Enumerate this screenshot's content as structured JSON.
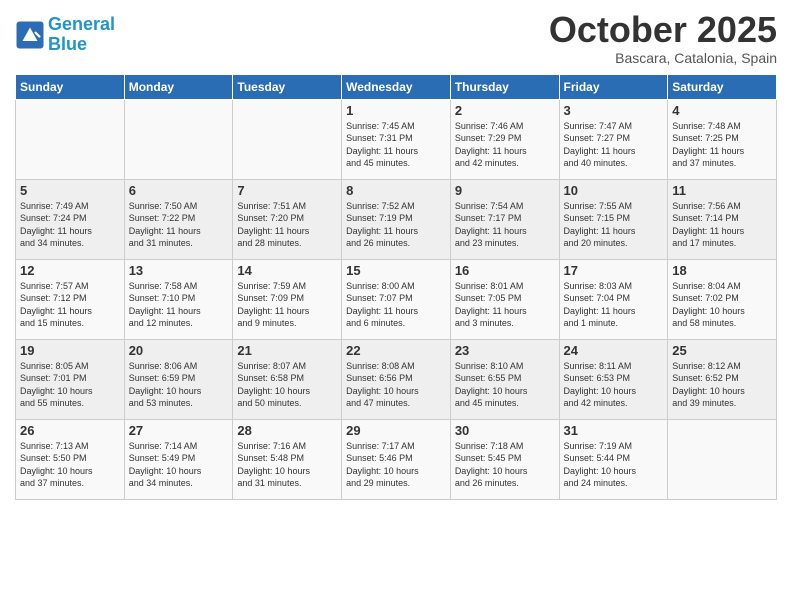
{
  "header": {
    "logo_line1": "General",
    "logo_line2": "Blue",
    "month": "October 2025",
    "location": "Bascara, Catalonia, Spain"
  },
  "days_of_week": [
    "Sunday",
    "Monday",
    "Tuesday",
    "Wednesday",
    "Thursday",
    "Friday",
    "Saturday"
  ],
  "weeks": [
    [
      {
        "day": "",
        "info": ""
      },
      {
        "day": "",
        "info": ""
      },
      {
        "day": "",
        "info": ""
      },
      {
        "day": "1",
        "info": "Sunrise: 7:45 AM\nSunset: 7:31 PM\nDaylight: 11 hours\nand 45 minutes."
      },
      {
        "day": "2",
        "info": "Sunrise: 7:46 AM\nSunset: 7:29 PM\nDaylight: 11 hours\nand 42 minutes."
      },
      {
        "day": "3",
        "info": "Sunrise: 7:47 AM\nSunset: 7:27 PM\nDaylight: 11 hours\nand 40 minutes."
      },
      {
        "day": "4",
        "info": "Sunrise: 7:48 AM\nSunset: 7:25 PM\nDaylight: 11 hours\nand 37 minutes."
      }
    ],
    [
      {
        "day": "5",
        "info": "Sunrise: 7:49 AM\nSunset: 7:24 PM\nDaylight: 11 hours\nand 34 minutes."
      },
      {
        "day": "6",
        "info": "Sunrise: 7:50 AM\nSunset: 7:22 PM\nDaylight: 11 hours\nand 31 minutes."
      },
      {
        "day": "7",
        "info": "Sunrise: 7:51 AM\nSunset: 7:20 PM\nDaylight: 11 hours\nand 28 minutes."
      },
      {
        "day": "8",
        "info": "Sunrise: 7:52 AM\nSunset: 7:19 PM\nDaylight: 11 hours\nand 26 minutes."
      },
      {
        "day": "9",
        "info": "Sunrise: 7:54 AM\nSunset: 7:17 PM\nDaylight: 11 hours\nand 23 minutes."
      },
      {
        "day": "10",
        "info": "Sunrise: 7:55 AM\nSunset: 7:15 PM\nDaylight: 11 hours\nand 20 minutes."
      },
      {
        "day": "11",
        "info": "Sunrise: 7:56 AM\nSunset: 7:14 PM\nDaylight: 11 hours\nand 17 minutes."
      }
    ],
    [
      {
        "day": "12",
        "info": "Sunrise: 7:57 AM\nSunset: 7:12 PM\nDaylight: 11 hours\nand 15 minutes."
      },
      {
        "day": "13",
        "info": "Sunrise: 7:58 AM\nSunset: 7:10 PM\nDaylight: 11 hours\nand 12 minutes."
      },
      {
        "day": "14",
        "info": "Sunrise: 7:59 AM\nSunset: 7:09 PM\nDaylight: 11 hours\nand 9 minutes."
      },
      {
        "day": "15",
        "info": "Sunrise: 8:00 AM\nSunset: 7:07 PM\nDaylight: 11 hours\nand 6 minutes."
      },
      {
        "day": "16",
        "info": "Sunrise: 8:01 AM\nSunset: 7:05 PM\nDaylight: 11 hours\nand 3 minutes."
      },
      {
        "day": "17",
        "info": "Sunrise: 8:03 AM\nSunset: 7:04 PM\nDaylight: 11 hours\nand 1 minute."
      },
      {
        "day": "18",
        "info": "Sunrise: 8:04 AM\nSunset: 7:02 PM\nDaylight: 10 hours\nand 58 minutes."
      }
    ],
    [
      {
        "day": "19",
        "info": "Sunrise: 8:05 AM\nSunset: 7:01 PM\nDaylight: 10 hours\nand 55 minutes."
      },
      {
        "day": "20",
        "info": "Sunrise: 8:06 AM\nSunset: 6:59 PM\nDaylight: 10 hours\nand 53 minutes."
      },
      {
        "day": "21",
        "info": "Sunrise: 8:07 AM\nSunset: 6:58 PM\nDaylight: 10 hours\nand 50 minutes."
      },
      {
        "day": "22",
        "info": "Sunrise: 8:08 AM\nSunset: 6:56 PM\nDaylight: 10 hours\nand 47 minutes."
      },
      {
        "day": "23",
        "info": "Sunrise: 8:10 AM\nSunset: 6:55 PM\nDaylight: 10 hours\nand 45 minutes."
      },
      {
        "day": "24",
        "info": "Sunrise: 8:11 AM\nSunset: 6:53 PM\nDaylight: 10 hours\nand 42 minutes."
      },
      {
        "day": "25",
        "info": "Sunrise: 8:12 AM\nSunset: 6:52 PM\nDaylight: 10 hours\nand 39 minutes."
      }
    ],
    [
      {
        "day": "26",
        "info": "Sunrise: 7:13 AM\nSunset: 5:50 PM\nDaylight: 10 hours\nand 37 minutes."
      },
      {
        "day": "27",
        "info": "Sunrise: 7:14 AM\nSunset: 5:49 PM\nDaylight: 10 hours\nand 34 minutes."
      },
      {
        "day": "28",
        "info": "Sunrise: 7:16 AM\nSunset: 5:48 PM\nDaylight: 10 hours\nand 31 minutes."
      },
      {
        "day": "29",
        "info": "Sunrise: 7:17 AM\nSunset: 5:46 PM\nDaylight: 10 hours\nand 29 minutes."
      },
      {
        "day": "30",
        "info": "Sunrise: 7:18 AM\nSunset: 5:45 PM\nDaylight: 10 hours\nand 26 minutes."
      },
      {
        "day": "31",
        "info": "Sunrise: 7:19 AM\nSunset: 5:44 PM\nDaylight: 10 hours\nand 24 minutes."
      },
      {
        "day": "",
        "info": ""
      }
    ]
  ]
}
